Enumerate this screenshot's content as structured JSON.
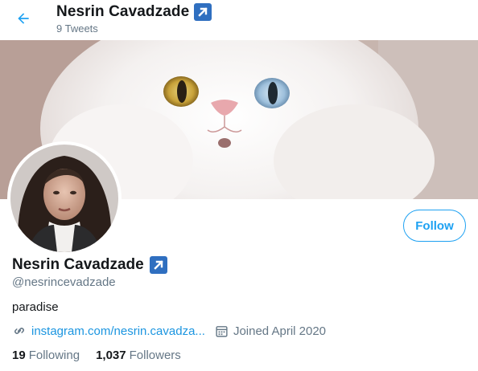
{
  "header": {
    "name": "Nesrin Cavadzade",
    "tweet_count": "9 Tweets"
  },
  "profile": {
    "name": "Nesrin Cavadzade",
    "handle": "@nesrincevadzade",
    "bio": "paradise",
    "website": "instagram.com/nesrin.cavadza...",
    "joined": "Joined April 2020",
    "follow_label": "Follow"
  },
  "stats": {
    "following_count": "19",
    "following_label": "Following",
    "followers_count": "1,037",
    "followers_label": "Followers"
  },
  "icons": {
    "back": "arrow-left-icon",
    "badge": "arrow-up-right-badge-icon",
    "link": "link-icon",
    "calendar": "calendar-icon"
  },
  "colors": {
    "accent": "#1da1f2",
    "link": "#1b95e0",
    "badge": "#2f6fc0",
    "muted": "#657786",
    "text": "#14171a"
  }
}
